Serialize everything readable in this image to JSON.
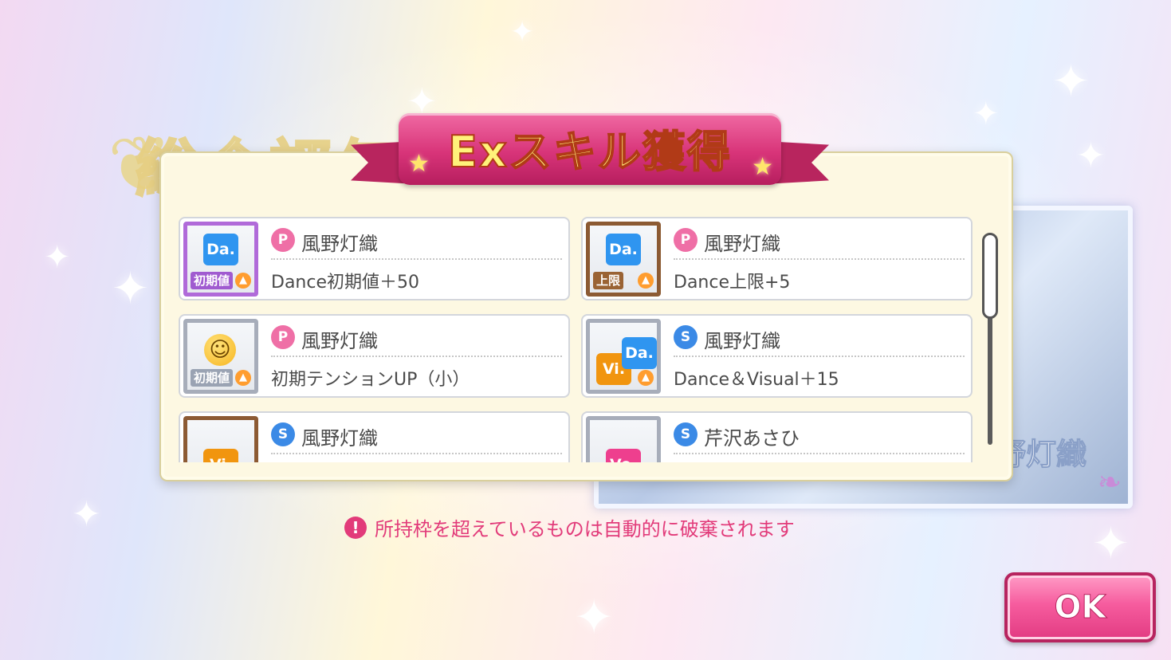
{
  "header": {
    "title": "Exスキル獲得"
  },
  "background": {
    "title": "総合評価",
    "card_name": "風野灯織"
  },
  "skills": [
    {
      "idol": "風野灯織",
      "type_chip": "P",
      "description": "Dance初期値＋50",
      "badge": "Da.",
      "label": "初期値",
      "frame": "purple"
    },
    {
      "idol": "風野灯織",
      "type_chip": "P",
      "description": "Dance上限+5",
      "badge": "Da.",
      "label": "上限",
      "frame": "brown"
    },
    {
      "idol": "風野灯織",
      "type_chip": "P",
      "description": "初期テンションUP（小）",
      "badge": "",
      "label": "初期値",
      "frame": "gray"
    },
    {
      "idol": "風野灯織",
      "type_chip": "S",
      "description": "Dance＆Visual＋15",
      "badge": "Da.",
      "badge2": "Vi.",
      "label": "",
      "frame": "gray"
    },
    {
      "idol": "風野灯織",
      "type_chip": "S",
      "description": "",
      "badge": "Vi.",
      "label": "",
      "frame": "brown"
    },
    {
      "idol": "芹沢あさひ",
      "type_chip": "S",
      "description": "",
      "badge": "Vo.",
      "label": "",
      "frame": "gray"
    }
  ],
  "notice": {
    "icon": "!",
    "text": "所持枠を超えているものは自動的に破棄されます"
  },
  "ok_button": {
    "label": "OK"
  },
  "colors": {
    "accent_pink": "#e23b7a",
    "ribbon": "#d83479",
    "dance": "#2f95f0",
    "visual": "#f1950f",
    "vocal": "#ee3f8e"
  }
}
